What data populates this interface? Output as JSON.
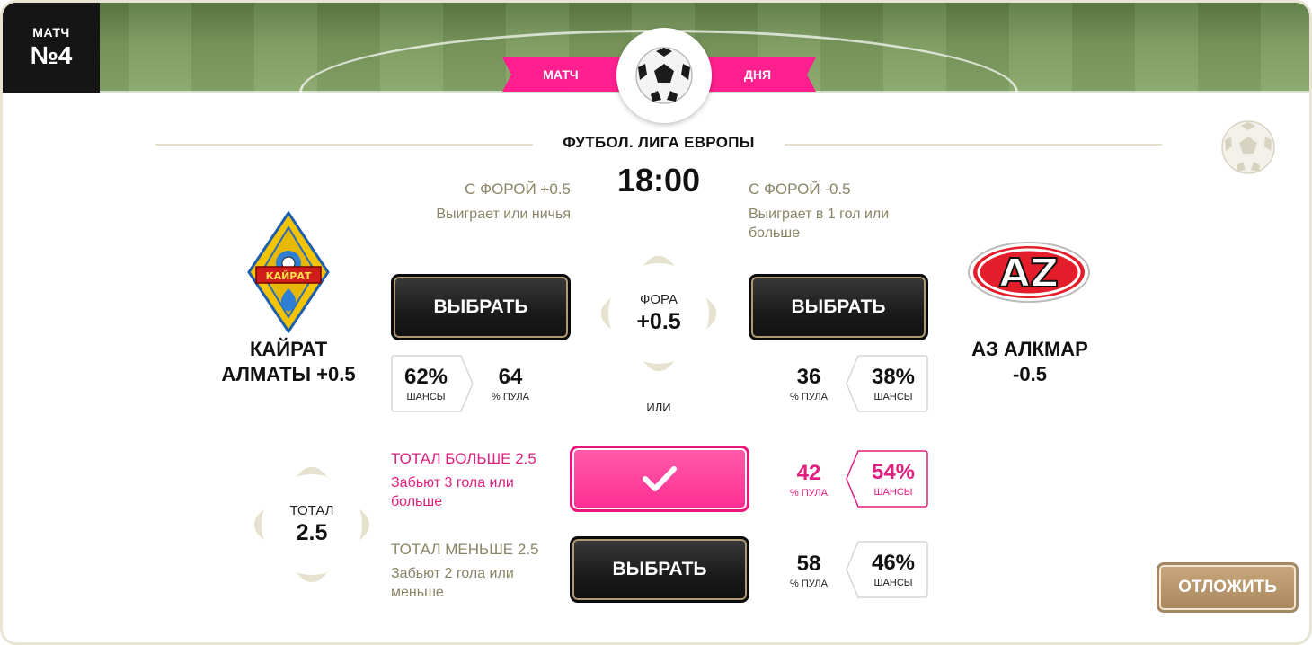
{
  "header": {
    "match_label": "МАТЧ",
    "match_number": "№4",
    "ribbon_left": "МАТЧ",
    "ribbon_right": "ДНЯ"
  },
  "event": {
    "league": "ФУТБОЛ. ЛИГА ЕВРОПЫ",
    "time": "18:00"
  },
  "teams": {
    "home": {
      "name_line1": "КАЙРАТ",
      "name_line2": "АЛМАТЫ +0.5",
      "logo_text": "КАЙРАТ"
    },
    "away": {
      "name_line1": "АЗ АЛКМАР",
      "name_line2": "-0.5",
      "logo_text": "AZ"
    }
  },
  "handicap": {
    "center_label": "ФОРА",
    "center_value": "+0.5",
    "or_label": "ИЛИ",
    "home": {
      "title": "С ФОРОЙ +0.5",
      "desc": "Выиграет или ничья",
      "button": "ВЫБРАТЬ",
      "chance_pct": "62%",
      "chance_label": "ШАНСЫ",
      "pool_value": "64",
      "pool_label": "% ПУЛА"
    },
    "away": {
      "title": "С ФОРОЙ -0.5",
      "desc_line1": "Выиграет в 1 гол или",
      "desc_line2": "больше",
      "button": "ВЫБРАТЬ",
      "chance_pct": "38%",
      "chance_label": "ШАНСЫ",
      "pool_value": "36",
      "pool_label": "% ПУЛА"
    }
  },
  "total": {
    "center_label": "ТОТАЛ",
    "center_value": "2.5",
    "over": {
      "title": "ТОТАЛ БОЛЬШЕ 2.5",
      "desc_line1": "Забьют 3 гола или",
      "desc_line2": "больше",
      "selected": true,
      "pool_value": "42",
      "pool_label": "% ПУЛА",
      "chance_pct": "54%",
      "chance_label": "ШАНСЫ"
    },
    "under": {
      "title": "ТОТАЛ МЕНЬШЕ 2.5",
      "desc_line1": "Забьют 2 гола или",
      "desc_line2": "меньше",
      "button": "ВЫБРАТЬ",
      "pool_value": "58",
      "pool_label": "% ПУЛА",
      "chance_pct": "46%",
      "chance_label": "ШАНСЫ"
    }
  },
  "actions": {
    "postpone": "ОТЛОЖИТЬ"
  },
  "colors": {
    "accent_pink": "#ff1f8e",
    "muted_text": "#8a8566",
    "selected_text": "#e0207f",
    "button_dark": "#1b1b1b",
    "postpone_gold": "#b8956b"
  }
}
